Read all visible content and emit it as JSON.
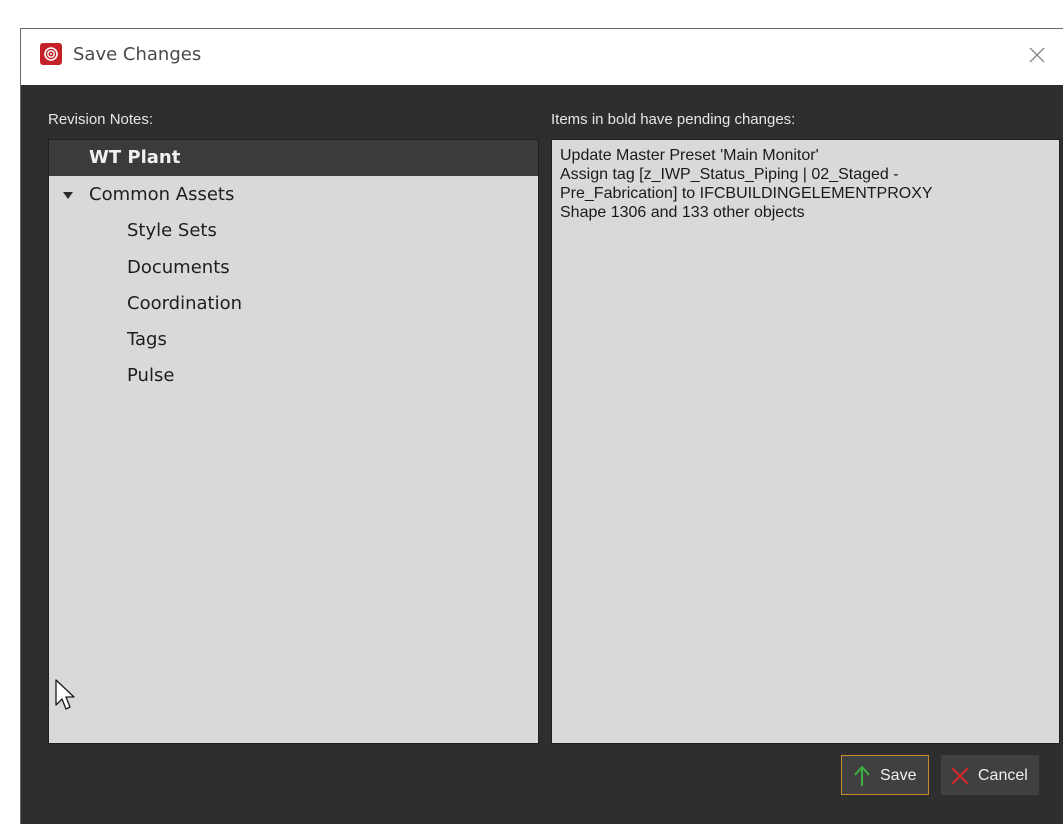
{
  "dialog": {
    "title": "Save Changes",
    "icon": "app-logo-icon",
    "close_icon": "close-icon"
  },
  "left": {
    "label": "Revision Notes:",
    "tree": [
      {
        "label": "WT Plant",
        "bold": true,
        "selected": true
      },
      {
        "label": "Common Assets",
        "expanded": true
      },
      {
        "label": "Style Sets"
      },
      {
        "label": "Documents"
      },
      {
        "label": "Coordination"
      },
      {
        "label": "Tags"
      },
      {
        "label": "Pulse"
      }
    ]
  },
  "right": {
    "label": "Items in bold have pending changes:",
    "lines": [
      "Update Master Preset 'Main Monitor'",
      "Assign tag [z_IWP_Status_Piping | 02_Staged -",
      "Pre_Fabrication] to IFCBUILDINGELEMENTPROXY",
      "Shape 1306 and 133 other objects"
    ]
  },
  "buttons": {
    "save": "Save",
    "cancel": "Cancel"
  },
  "colors": {
    "accent_save": "#3cb043",
    "accent_cancel": "#d8282f",
    "save_border": "#c98a2e",
    "dialog_bg": "#2e2e2e"
  }
}
